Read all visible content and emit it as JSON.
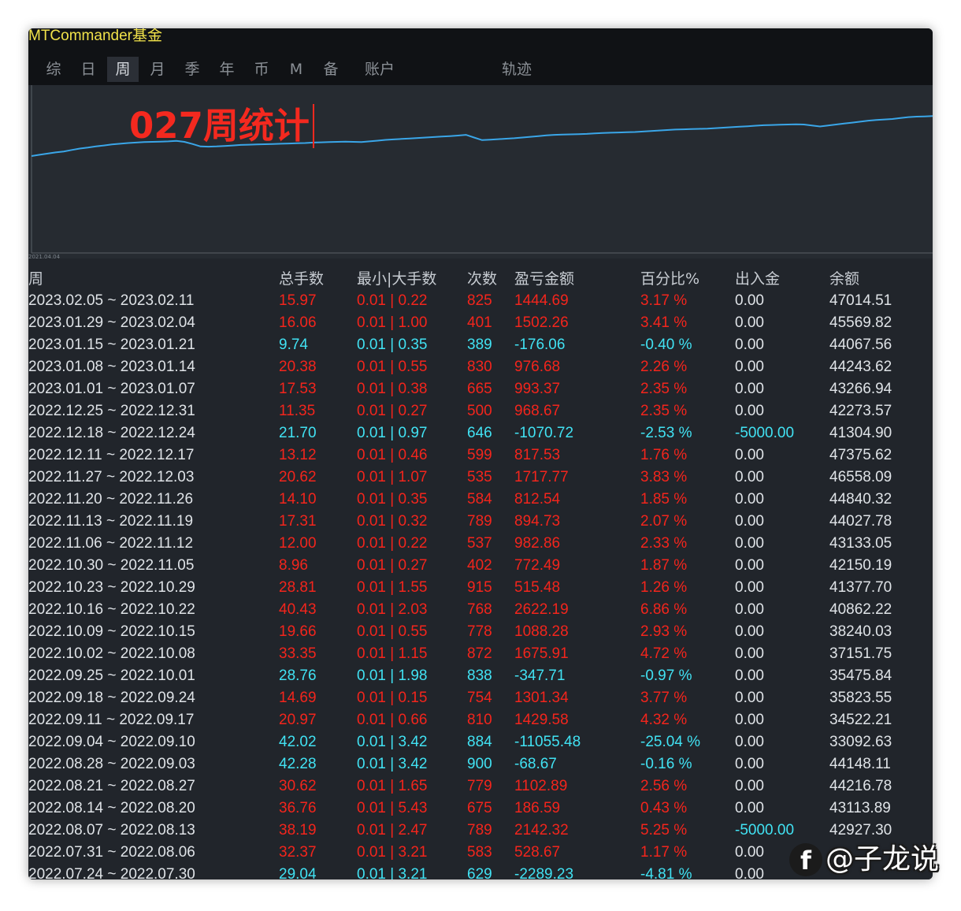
{
  "window": {
    "title": "MTCommander基金"
  },
  "tabs": [
    {
      "label": "综",
      "active": false
    },
    {
      "label": "日",
      "active": false
    },
    {
      "label": "周",
      "active": true
    },
    {
      "label": "月",
      "active": false
    },
    {
      "label": "季",
      "active": false
    },
    {
      "label": "年",
      "active": false
    },
    {
      "label": "币",
      "active": false
    },
    {
      "label": "M",
      "active": false
    },
    {
      "label": "备",
      "active": false
    },
    {
      "label": "账户",
      "active": false
    },
    {
      "label": "轨迹",
      "active": false
    }
  ],
  "chart": {
    "heading": "027周统计",
    "x_start_label": "2021.04.04",
    "line_color": "#3aa6e8",
    "balance_curve": [
      30.5,
      31,
      31.5,
      32,
      32.4,
      33,
      33.6,
      34,
      34.5,
      34.9,
      35.3,
      35.6,
      35.9,
      36.1,
      36.3,
      36.4,
      36.5,
      36.6,
      36.8,
      36.4,
      35.5,
      34.5,
      34.4,
      34.5,
      34.7,
      34.9,
      35.1,
      35.2,
      35.3,
      35.4,
      35.5,
      35.6,
      35.7,
      35.8,
      35.9,
      36.1,
      36.2,
      36.3,
      36.4,
      36.5,
      36.4,
      36.3,
      36.6,
      36.9,
      37.2,
      37.4,
      37.6,
      37.8,
      38,
      38.2,
      38.4,
      38.6,
      38.8,
      39,
      39.3,
      38.2,
      37.1,
      37.3,
      37.5,
      37.7,
      37.9,
      38.2,
      38.5,
      38.8,
      39.1,
      39.3,
      39.4,
      39.5,
      39.6,
      39.7,
      39.9,
      40.1,
      40.2,
      40.3,
      40.4,
      40.5,
      40.7,
      40.9,
      41.1,
      41.3,
      41.5,
      41.6,
      41.7,
      41.8,
      41.9,
      42.1,
      42.3,
      42.5,
      42.7,
      42.9,
      43.1,
      43.3,
      43.4,
      43.5,
      43.6,
      43.7,
      43.6,
      43.2,
      42.8,
      43.2,
      43.6,
      44,
      44.4,
      44.8,
      45.2,
      45.5,
      45.7,
      45.9,
      46.3,
      46.7,
      46.9,
      47.0,
      47.1
    ]
  },
  "table": {
    "headers": {
      "week": "周",
      "lots_total": "总手数",
      "lots_minmax": "最小|大手数",
      "count": "次数",
      "pnl": "盈亏金额",
      "pct": "百分比%",
      "deposit": "出入金",
      "balance": "余额"
    },
    "rows": [
      {
        "week": "2023.02.05 ~ 2023.02.11",
        "lots": "15.97",
        "minmax": "0.01 | 0.22",
        "count": "825",
        "pnl": "1444.69",
        "pct": "3.17 %",
        "deposit": "0.00",
        "balance": "47014.51",
        "color": "red"
      },
      {
        "week": "2023.01.29 ~ 2023.02.04",
        "lots": "16.06",
        "minmax": "0.01 | 1.00",
        "count": "401",
        "pnl": "1502.26",
        "pct": "3.41 %",
        "deposit": "0.00",
        "balance": "45569.82",
        "color": "red"
      },
      {
        "week": "2023.01.15 ~ 2023.01.21",
        "lots": "9.74",
        "minmax": "0.01 | 0.35",
        "count": "389",
        "pnl": "-176.06",
        "pct": "-0.40 %",
        "deposit": "0.00",
        "balance": "44067.56",
        "color": "cyan"
      },
      {
        "week": "2023.01.08 ~ 2023.01.14",
        "lots": "20.38",
        "minmax": "0.01 | 0.55",
        "count": "830",
        "pnl": "976.68",
        "pct": "2.26 %",
        "deposit": "0.00",
        "balance": "44243.62",
        "color": "red"
      },
      {
        "week": "2023.01.01 ~ 2023.01.07",
        "lots": "17.53",
        "minmax": "0.01 | 0.38",
        "count": "665",
        "pnl": "993.37",
        "pct": "2.35 %",
        "deposit": "0.00",
        "balance": "43266.94",
        "color": "red"
      },
      {
        "week": "2022.12.25 ~ 2022.12.31",
        "lots": "11.35",
        "minmax": "0.01 | 0.27",
        "count": "500",
        "pnl": "968.67",
        "pct": "2.35 %",
        "deposit": "0.00",
        "balance": "42273.57",
        "color": "red"
      },
      {
        "week": "2022.12.18 ~ 2022.12.24",
        "lots": "21.70",
        "minmax": "0.01 | 0.97",
        "count": "646",
        "pnl": "-1070.72",
        "pct": "-2.53 %",
        "deposit": "-5000.00",
        "balance": "41304.90",
        "color": "cyan",
        "deposit_color": "cyan"
      },
      {
        "week": "2022.12.11 ~ 2022.12.17",
        "lots": "13.12",
        "minmax": "0.01 | 0.46",
        "count": "599",
        "pnl": "817.53",
        "pct": "1.76 %",
        "deposit": "0.00",
        "balance": "47375.62",
        "color": "red"
      },
      {
        "week": "2022.11.27 ~ 2022.12.03",
        "lots": "20.62",
        "minmax": "0.01 | 1.07",
        "count": "535",
        "pnl": "1717.77",
        "pct": "3.83 %",
        "deposit": "0.00",
        "balance": "46558.09",
        "color": "red"
      },
      {
        "week": "2022.11.20 ~ 2022.11.26",
        "lots": "14.10",
        "minmax": "0.01 | 0.35",
        "count": "584",
        "pnl": "812.54",
        "pct": "1.85 %",
        "deposit": "0.00",
        "balance": "44840.32",
        "color": "red"
      },
      {
        "week": "2022.11.13 ~ 2022.11.19",
        "lots": "17.31",
        "minmax": "0.01 | 0.32",
        "count": "789",
        "pnl": "894.73",
        "pct": "2.07 %",
        "deposit": "0.00",
        "balance": "44027.78",
        "color": "red"
      },
      {
        "week": "2022.11.06 ~ 2022.11.12",
        "lots": "12.00",
        "minmax": "0.01 | 0.22",
        "count": "537",
        "pnl": "982.86",
        "pct": "2.33 %",
        "deposit": "0.00",
        "balance": "43133.05",
        "color": "red"
      },
      {
        "week": "2022.10.30 ~ 2022.11.05",
        "lots": "8.96",
        "minmax": "0.01 | 0.27",
        "count": "402",
        "pnl": "772.49",
        "pct": "1.87 %",
        "deposit": "0.00",
        "balance": "42150.19",
        "color": "red"
      },
      {
        "week": "2022.10.23 ~ 2022.10.29",
        "lots": "28.81",
        "minmax": "0.01 | 1.55",
        "count": "915",
        "pnl": "515.48",
        "pct": "1.26 %",
        "deposit": "0.00",
        "balance": "41377.70",
        "color": "red"
      },
      {
        "week": "2022.10.16 ~ 2022.10.22",
        "lots": "40.43",
        "minmax": "0.01 | 2.03",
        "count": "768",
        "pnl": "2622.19",
        "pct": "6.86 %",
        "deposit": "0.00",
        "balance": "40862.22",
        "color": "red"
      },
      {
        "week": "2022.10.09 ~ 2022.10.15",
        "lots": "19.66",
        "minmax": "0.01 | 0.55",
        "count": "778",
        "pnl": "1088.28",
        "pct": "2.93 %",
        "deposit": "0.00",
        "balance": "38240.03",
        "color": "red"
      },
      {
        "week": "2022.10.02 ~ 2022.10.08",
        "lots": "33.35",
        "minmax": "0.01 | 1.15",
        "count": "872",
        "pnl": "1675.91",
        "pct": "4.72 %",
        "deposit": "0.00",
        "balance": "37151.75",
        "color": "red"
      },
      {
        "week": "2022.09.25 ~ 2022.10.01",
        "lots": "28.76",
        "minmax": "0.01 | 1.98",
        "count": "838",
        "pnl": "-347.71",
        "pct": "-0.97 %",
        "deposit": "0.00",
        "balance": "35475.84",
        "color": "cyan"
      },
      {
        "week": "2022.09.18 ~ 2022.09.24",
        "lots": "14.69",
        "minmax": "0.01 | 0.15",
        "count": "754",
        "pnl": "1301.34",
        "pct": "3.77 %",
        "deposit": "0.00",
        "balance": "35823.55",
        "color": "red"
      },
      {
        "week": "2022.09.11 ~ 2022.09.17",
        "lots": "20.97",
        "minmax": "0.01 | 0.66",
        "count": "810",
        "pnl": "1429.58",
        "pct": "4.32 %",
        "deposit": "0.00",
        "balance": "34522.21",
        "color": "red"
      },
      {
        "week": "2022.09.04 ~ 2022.09.10",
        "lots": "42.02",
        "minmax": "0.01 | 3.42",
        "count": "884",
        "pnl": "-11055.48",
        "pct": "-25.04 %",
        "deposit": "0.00",
        "balance": "33092.63",
        "color": "cyan"
      },
      {
        "week": "2022.08.28 ~ 2022.09.03",
        "lots": "42.28",
        "minmax": "0.01 | 3.42",
        "count": "900",
        "pnl": "-68.67",
        "pct": "-0.16 %",
        "deposit": "0.00",
        "balance": "44148.11",
        "color": "cyan"
      },
      {
        "week": "2022.08.21 ~ 2022.08.27",
        "lots": "30.62",
        "minmax": "0.01 | 1.65",
        "count": "779",
        "pnl": "1102.89",
        "pct": "2.56 %",
        "deposit": "0.00",
        "balance": "44216.78",
        "color": "red"
      },
      {
        "week": "2022.08.14 ~ 2022.08.20",
        "lots": "36.76",
        "minmax": "0.01 | 5.43",
        "count": "675",
        "pnl": "186.59",
        "pct": "0.43 %",
        "deposit": "0.00",
        "balance": "43113.89",
        "color": "red"
      },
      {
        "week": "2022.08.07 ~ 2022.08.13",
        "lots": "38.19",
        "minmax": "0.01 | 2.47",
        "count": "789",
        "pnl": "2142.32",
        "pct": "5.25 %",
        "deposit": "-5000.00",
        "balance": "42927.30",
        "color": "red",
        "deposit_color": "cyan"
      },
      {
        "week": "2022.07.31 ~ 2022.08.06",
        "lots": "32.37",
        "minmax": "0.01 | 3.21",
        "count": "583",
        "pnl": "528.67",
        "pct": "1.17 %",
        "deposit": "0.00",
        "balance": "",
        "color": "red"
      },
      {
        "week": "2022.07.24 ~ 2022.07.30",
        "lots": "29.04",
        "minmax": "0.01 | 3.21",
        "count": "629",
        "pnl": "-2289.23",
        "pct": "-4.81 %",
        "deposit": "0.00",
        "balance": "",
        "color": "cyan"
      }
    ]
  },
  "watermark": {
    "logo_glyph": "f",
    "text": "@子龙说"
  }
}
